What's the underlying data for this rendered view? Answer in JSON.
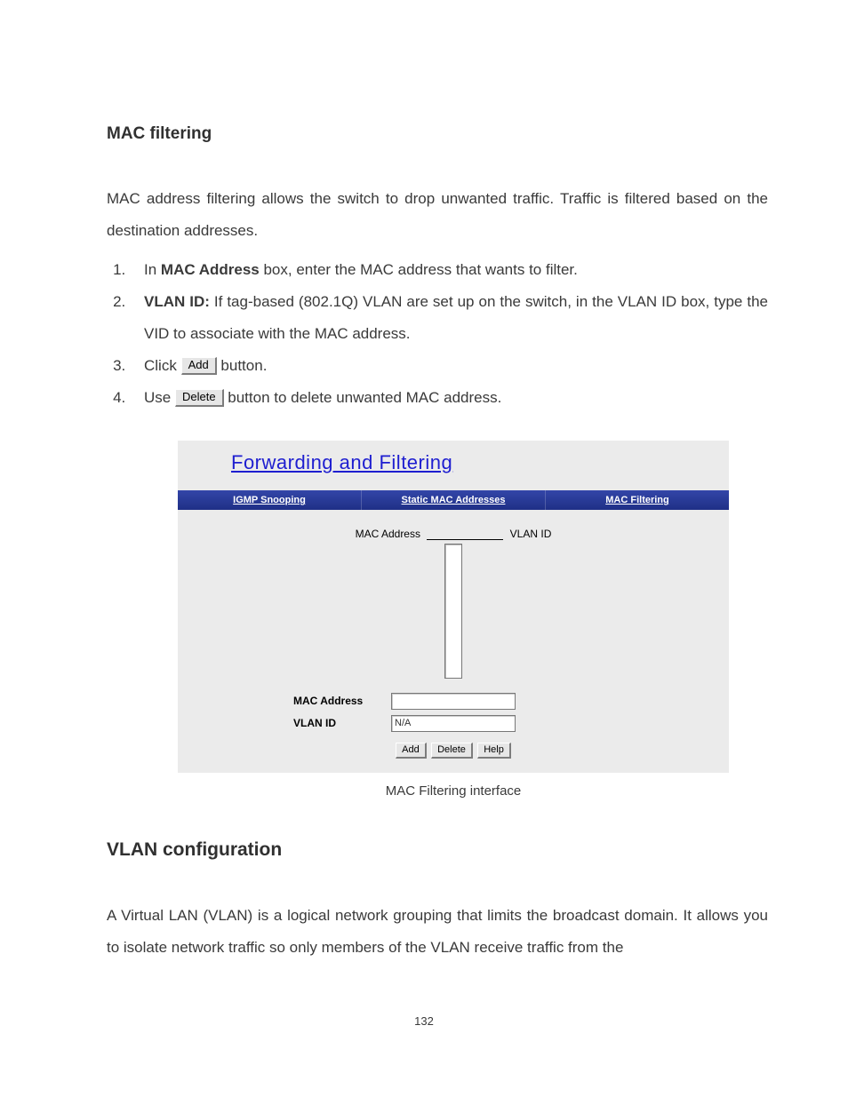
{
  "section1": {
    "heading": "MAC filtering",
    "intro": "MAC address filtering allows the switch to drop unwanted traffic. Traffic is filtered based on the destination addresses.",
    "step1_prefix": "In ",
    "step1_bold": "MAC Address",
    "step1_suffix": " box, enter the MAC address that wants to filter.",
    "step2_bold": "VLAN ID:",
    "step2_rest": " If tag-based (802.1Q) VLAN are set up on the switch, in the VLAN ID box, type the VID to associate with the MAC address.",
    "step3_prefix": "Click ",
    "step3_btn": "Add",
    "step3_suffix": " button.",
    "step4_prefix": "Use ",
    "step4_btn": "Delete",
    "step4_suffix": " button to delete unwanted MAC address."
  },
  "figure": {
    "title": "Forwarding and Filtering",
    "tabs": {
      "igmp": "IGMP Snooping",
      "static": "Static MAC Addresses",
      "macf": "MAC Filtering"
    },
    "list_header_left": "MAC Address",
    "list_header_right": "VLAN ID",
    "form": {
      "mac_label": "MAC Address",
      "mac_value": "",
      "vlan_label": "VLAN ID",
      "vlan_value": "N/A"
    },
    "buttons": {
      "add": "Add",
      "delete": "Delete",
      "help": "Help"
    },
    "caption": "MAC Filtering interface"
  },
  "section2": {
    "heading": "VLAN configuration",
    "para": "A Virtual LAN (VLAN) is a logical network grouping that limits the broadcast domain. It allows you to isolate network traffic so only members of the VLAN receive traffic from the"
  },
  "page_number": "132"
}
